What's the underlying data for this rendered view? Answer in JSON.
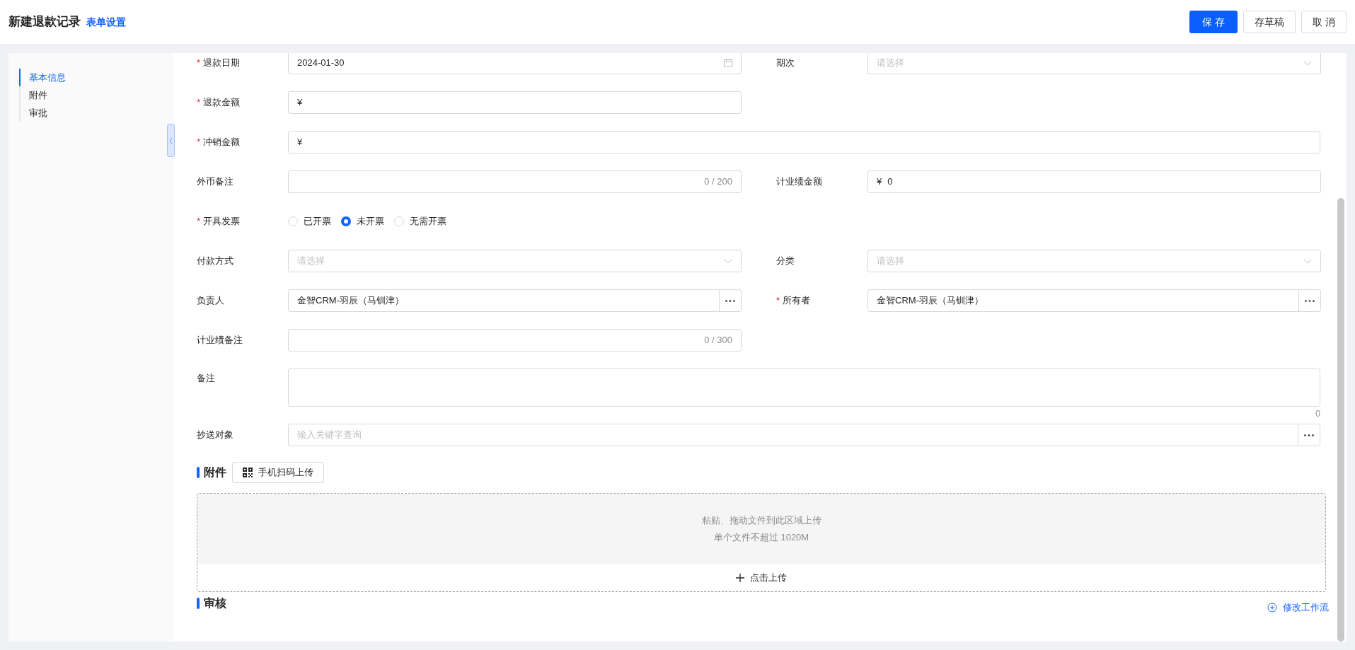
{
  "header": {
    "title": "新建退款记录",
    "link": "表单设置",
    "buttons": [
      {
        "label": "保 存",
        "kind": "primary"
      },
      {
        "label": "存草稿",
        "kind": "default"
      },
      {
        "label": "取 消",
        "kind": "default"
      }
    ]
  },
  "nav": [
    {
      "label": "基本信息",
      "selected": true
    },
    {
      "label": "附件",
      "selected": false
    },
    {
      "label": "审批",
      "selected": false
    }
  ],
  "form": {
    "rows": [
      {
        "fields": [
          {
            "label": "退款日期",
            "required_mark": "*",
            "kind": "date",
            "value": "2024-01-30"
          },
          {
            "label": "期次",
            "kind": "select",
            "placeholder": "请选择"
          }
        ]
      },
      {
        "fields": [
          {
            "label": "退款金额",
            "required_mark": "*",
            "kind": "money",
            "prefix": "¥"
          }
        ]
      },
      {
        "fields": [
          {
            "label": "冲销金额",
            "required_mark": "*",
            "kind": "money",
            "prefix": "¥",
            "wide": true
          }
        ]
      },
      {
        "fields": [
          {
            "label": "外币备注",
            "kind": "counter",
            "counter": "0 / 200"
          },
          {
            "label": "计业绩金额",
            "kind": "money",
            "prefix": "¥",
            "value": "0"
          }
        ]
      },
      {
        "fields": [
          {
            "label": "开具发票",
            "required_mark": "*",
            "kind": "radio",
            "options": [
              {
                "label": "已开票",
                "selected": false
              },
              {
                "label": "未开票",
                "selected": true
              },
              {
                "label": "无需开票",
                "selected": false
              }
            ]
          }
        ]
      },
      {
        "fields": [
          {
            "label": "付款方式",
            "kind": "select",
            "placeholder": "请选择"
          },
          {
            "label": "分类",
            "kind": "select",
            "placeholder": "请选择"
          }
        ]
      },
      {
        "fields": [
          {
            "label": "负责人",
            "kind": "picker",
            "value": "金智CRM-羽辰（马钏津）"
          },
          {
            "label": "所有者",
            "required_mark": "*",
            "kind": "picker",
            "value": "金智CRM-羽辰（马钏津）"
          }
        ]
      },
      {
        "fields": [
          {
            "label": "计业绩备注",
            "kind": "counter",
            "counter": "0 / 300"
          }
        ]
      },
      {
        "fields": [
          {
            "label": "备注",
            "kind": "textarea",
            "counter": "0",
            "wide": true
          }
        ]
      },
      {
        "fields": [
          {
            "label": "抄送对象",
            "kind": "picker",
            "placeholder": "输入关键字查询",
            "wide": true
          }
        ]
      }
    ]
  },
  "attachments": {
    "title": "附件",
    "scan_button": "手机扫码上传",
    "drop_lines": [
      "粘贴、拖动文件到此区域上传",
      "单个文件不超过 1020M"
    ],
    "upload_button": "点击上传"
  },
  "review": {
    "title": "审核",
    "action": "修改工作流"
  }
}
